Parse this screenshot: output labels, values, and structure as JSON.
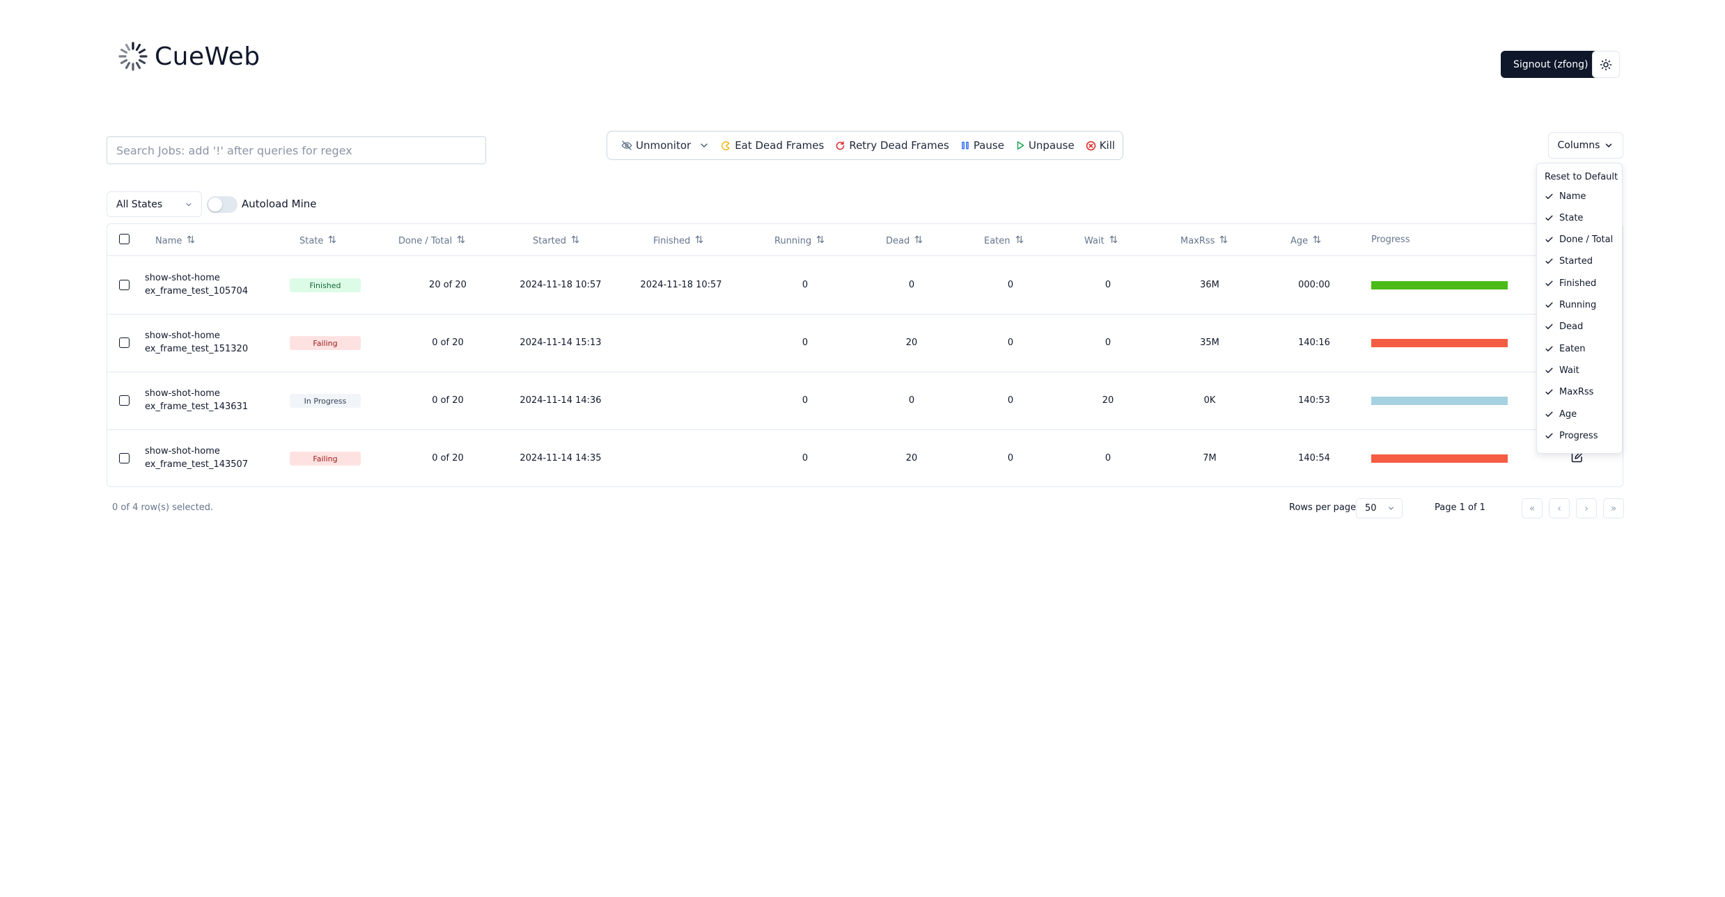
{
  "app": {
    "title": "CueWeb"
  },
  "header": {
    "signout_label": "Signout (zfong)",
    "theme_icon": "sun-icon"
  },
  "search": {
    "placeholder": "Search Jobs: add '!' after queries for regex",
    "value": ""
  },
  "toolbar": {
    "unmonitor": "Unmonitor",
    "eat_dead_frames": "Eat Dead Frames",
    "retry_dead_frames": "Retry Dead Frames",
    "pause": "Pause",
    "unpause": "Unpause",
    "kill": "Kill"
  },
  "columns_button": "Columns",
  "filters": {
    "state_select": "All States",
    "autoload_label": "Autoload Mine",
    "autoload_on": false
  },
  "table": {
    "headers": {
      "name": "Name",
      "state": "State",
      "done_total": "Done / Total",
      "started": "Started",
      "finished": "Finished",
      "running": "Running",
      "dead": "Dead",
      "eaten": "Eaten",
      "wait": "Wait",
      "maxrss": "MaxRss",
      "age": "Age",
      "progress": "Progress"
    },
    "rows": [
      {
        "name_line1": "show-shot-home",
        "name_line2": "ex_frame_test_105704",
        "state": "Finished",
        "done_total": "20 of 20",
        "started": "2024-11-18 10:57",
        "finished": "2024-11-18 10:57",
        "running": "0",
        "dead": "0",
        "eaten": "0",
        "wait": "0",
        "maxrss": "36M",
        "age": "000:00",
        "progress_color": "#4cbb17"
      },
      {
        "name_line1": "show-shot-home",
        "name_line2": "ex_frame_test_151320",
        "state": "Failing",
        "done_total": "0 of 20",
        "started": "2024-11-14 15:13",
        "finished": "",
        "running": "0",
        "dead": "20",
        "eaten": "0",
        "wait": "0",
        "maxrss": "35M",
        "age": "140:16",
        "progress_color": "#f55d42"
      },
      {
        "name_line1": "show-shot-home",
        "name_line2": "ex_frame_test_143631",
        "state": "In Progress",
        "done_total": "0 of 20",
        "started": "2024-11-14 14:36",
        "finished": "",
        "running": "0",
        "dead": "0",
        "eaten": "0",
        "wait": "20",
        "maxrss": "0K",
        "age": "140:53",
        "progress_color": "#a6d1e0"
      },
      {
        "name_line1": "show-shot-home",
        "name_line2": "ex_frame_test_143507",
        "state": "Failing",
        "done_total": "0 of 20",
        "started": "2024-11-14 14:35",
        "finished": "",
        "running": "0",
        "dead": "20",
        "eaten": "0",
        "wait": "0",
        "maxrss": "7M",
        "age": "140:54",
        "progress_color": "#f55d42"
      }
    ]
  },
  "footer": {
    "selected": "0 of 4 row(s) selected.",
    "rows_per_page_label": "Rows per page",
    "rows_per_page_value": "50",
    "page_label": "Page 1 of 1",
    "first": "«",
    "prev": "‹",
    "next": "›",
    "last": "»"
  },
  "columns_menu": {
    "reset": "Reset to Default",
    "items": [
      "Name",
      "State",
      "Done / Total",
      "Started",
      "Finished",
      "Running",
      "Dead",
      "Eaten",
      "Wait",
      "MaxRss",
      "Age",
      "Progress"
    ]
  },
  "state_colors": {
    "Finished": {
      "bg": "#dcfce7",
      "fg": "#166534"
    },
    "Failing": {
      "bg": "#fee2e2",
      "fg": "#991b1b"
    },
    "In Progress": {
      "bg": "#f1f5f9",
      "fg": "#334155"
    }
  }
}
